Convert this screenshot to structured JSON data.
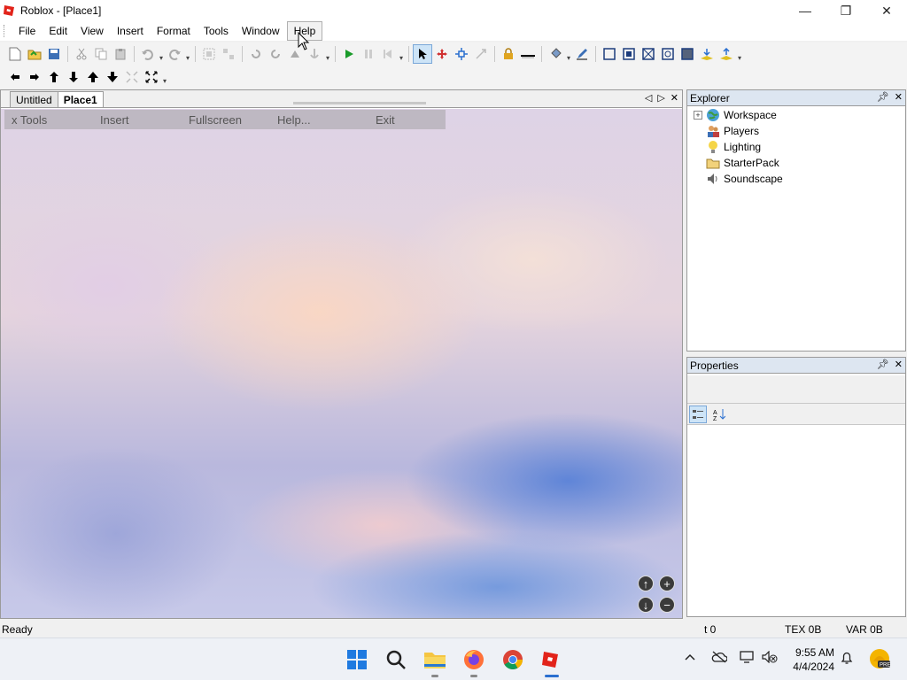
{
  "window": {
    "title": "Roblox - [Place1]",
    "controls": {
      "minimize": "—",
      "maximize": "❐",
      "close": "✕"
    }
  },
  "menu": {
    "items": [
      "File",
      "Edit",
      "View",
      "Insert",
      "Format",
      "Tools",
      "Window",
      "Help"
    ],
    "active": "Help"
  },
  "toolbar1": {
    "icons": [
      "new-icon",
      "open-icon",
      "save-icon",
      "cut-icon",
      "copy-icon",
      "paste-icon",
      "undo-icon",
      "redo-icon",
      "group-icon",
      "ungroup-icon",
      "rotate-left-icon",
      "rotate-right-icon",
      "up-icon",
      "anchor-icon",
      "play-icon",
      "pause-icon",
      "step-icon",
      "select-icon",
      "move-icon",
      "resize-icon",
      "scale-icon",
      "lock-icon",
      "ground-icon",
      "fill-icon",
      "pencil-icon",
      "box-icon",
      "box2-icon",
      "box3-icon",
      "box4-icon",
      "box5-icon",
      "surface-icon",
      "surface2-icon"
    ]
  },
  "toolbar2": {
    "icons": [
      "arrow-left-icon",
      "arrow-right-icon",
      "arrow-up-icon",
      "arrow-down-curve-icon",
      "arrow-up-bold-icon",
      "arrow-down-bold-icon",
      "collapse-icon",
      "expand-icon"
    ]
  },
  "document": {
    "tabs": [
      {
        "label": "Untitled",
        "active": false
      },
      {
        "label": "Place1",
        "active": true
      }
    ],
    "ingame_menu": [
      "x Tools",
      "Insert",
      "Fullscreen",
      "Help...",
      "Exit"
    ]
  },
  "explorer": {
    "title": "Explorer",
    "items": [
      {
        "label": "Workspace",
        "icon": "globe-icon",
        "expandable": true
      },
      {
        "label": "Players",
        "icon": "players-icon",
        "expandable": false
      },
      {
        "label": "Lighting",
        "icon": "bulb-icon",
        "expandable": false
      },
      {
        "label": "StarterPack",
        "icon": "folder-icon",
        "expandable": false
      },
      {
        "label": "Soundscape",
        "icon": "speaker-icon",
        "expandable": false
      }
    ]
  },
  "properties": {
    "title": "Properties"
  },
  "statusbar": {
    "status": "Ready",
    "t": "t 0",
    "tex": "TEX 0B",
    "var": "VAR 0B"
  },
  "taskbar": {
    "time": "9:55 AM",
    "date": "4/4/2024"
  },
  "colors": {
    "accent": "#2a6fd0",
    "panel_header": "#dde6f1",
    "play_green": "#1a9b2a"
  }
}
